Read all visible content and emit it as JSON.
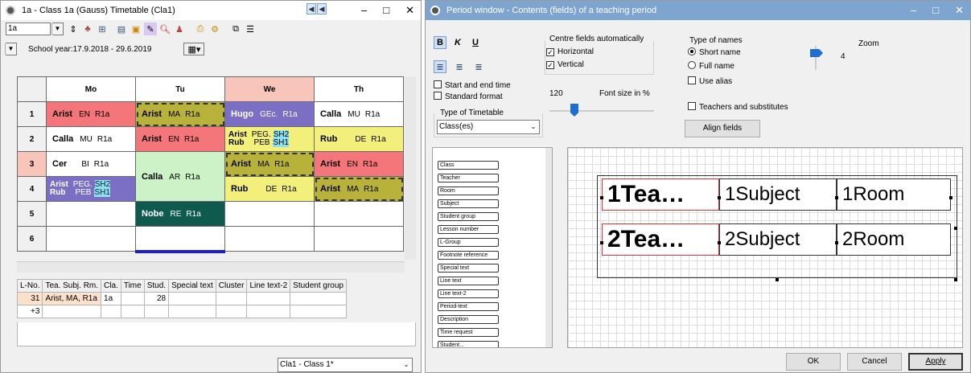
{
  "w1": {
    "title": "1a - Class 1a (Gauss) Timetable (Cla1)",
    "nav": [
      "◀",
      "◀"
    ],
    "class_select": "1a",
    "school_year": "School year:17.9.2018 - 29.6.2019",
    "days": [
      "Mo",
      "Tu",
      "We",
      "Th"
    ],
    "periods": [
      "1",
      "2",
      "3",
      "4",
      "5",
      "6"
    ],
    "cells": {
      "mo1": {
        "t": "Arist",
        "s": "EN",
        "r": "R1a"
      },
      "mo2": {
        "t": "Calla",
        "s": "MU",
        "r": "R1a"
      },
      "mo3": {
        "t": "Cer",
        "s": "BI",
        "r": "R1a"
      },
      "mo4": {
        "t1": "Arist",
        "s1": "PEG.",
        "r1": "SH2",
        "t2": "Rub",
        "s2": "PEB",
        "r2": "SH1"
      },
      "tu1": {
        "t": "Arist",
        "s": "MA",
        "r": "R1a"
      },
      "tu2": {
        "t": "Arist",
        "s": "EN",
        "r": "R1a"
      },
      "tu34": {
        "t": "Calla",
        "s": "AR",
        "r": "R1a"
      },
      "tu5": {
        "t": "Nobe",
        "s": "RE",
        "r": "R1a"
      },
      "we1": {
        "t": "Hugo",
        "s": "GEc.",
        "r": "R1a"
      },
      "we2": {
        "t1": "Arist",
        "s1": "PEG.",
        "r1": "SH2",
        "t2": "Rub",
        "s2": "PEB",
        "r2": "SH1"
      },
      "we3": {
        "t": "Arist",
        "s": "MA",
        "r": "R1a"
      },
      "we4": {
        "t": "Rub",
        "s": "DE",
        "r": "R1a"
      },
      "th1": {
        "t": "Calla",
        "s": "MU",
        "r": "R1a"
      },
      "th2": {
        "t": "Rub",
        "s": "DE",
        "r": "R1a"
      },
      "th3": {
        "t": "Arist",
        "s": "EN",
        "r": "R1a"
      },
      "th4": {
        "t": "Arist",
        "s": "MA",
        "r": "R1a"
      }
    },
    "lower_headers": [
      "L-No.",
      "Tea. Subj. Rm.",
      "Cla.",
      "Time",
      "Stud.",
      "Special text",
      "Cluster",
      "Line text-2",
      "Student group"
    ],
    "lower_rows": [
      [
        "31",
        "Arist, MA, R1a",
        "1a",
        "",
        "28",
        "",
        "",
        "",
        ""
      ],
      [
        "+3",
        "",
        "",
        "",
        "",
        "",
        "",
        "",
        ""
      ]
    ],
    "bottom_combo": "Cla1 - Class 1*",
    "colors": {
      "red": "#f4757a",
      "yellow": "#f2f07a",
      "green": "#cdf2c8",
      "purple": "#7a6fc4",
      "teal": "#0f5a4e",
      "olive": "#b8b23a",
      "salmon": "#f7c5b9"
    }
  },
  "w2": {
    "title": "Period window - Contents (fields) of a teaching period",
    "fmt": {
      "bold": "B",
      "italic": "K",
      "underline": "U"
    },
    "centre_label": "Centre fields automatically",
    "horizontal": "Horizontal",
    "vertical": "Vertical",
    "type_names_label": "Type of names",
    "short_name": "Short name",
    "full_name": "Full name",
    "use_alias": "Use alias",
    "zoom_label": "Zoom",
    "zoom_value": "4",
    "start_end": "Start and end time",
    "standard_format": "Standard format",
    "font_size_value": "120",
    "font_size_label": "Font size in %",
    "type_tt_label": "Type of Timetable",
    "type_tt_value": "Class(es)",
    "teachers_subs": "Teachers and substitutes",
    "align_fields": "Align fields",
    "fields": [
      "Class",
      "Teacher",
      "Room",
      "Subject",
      "Student group",
      "Lesson number",
      "L-Group",
      "Footnote reference",
      "Special text",
      "Line text",
      "Line text-2",
      "Period-text",
      "Description",
      "Time request",
      "Student..."
    ],
    "boxes": {
      "tea1": "1Tea…",
      "subj1": "1Subject",
      "room1": "1Room",
      "tea2": "2Tea…",
      "subj2": "2Subject",
      "room2": "2Room"
    },
    "ok": "OK",
    "cancel": "Cancel",
    "apply": "Apply"
  }
}
